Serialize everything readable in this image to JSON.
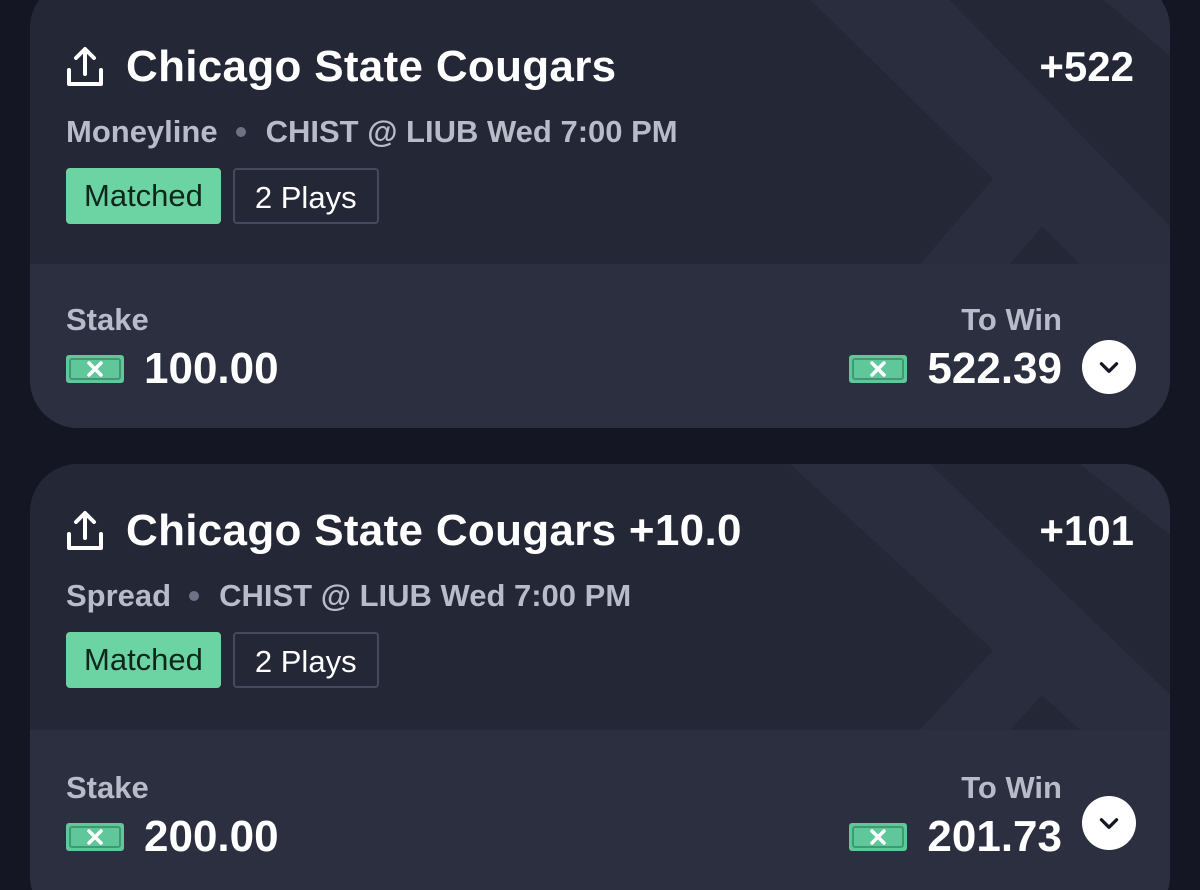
{
  "bets": [
    {
      "title": "Chicago State Cougars",
      "odds": "+522",
      "bet_type": "Moneyline",
      "matchup": "CHIST @ LIUB Wed 7:00 PM",
      "status": "Matched",
      "plays": "2 Plays",
      "stake_label": "Stake",
      "stake": "100.00",
      "win_label": "To Win",
      "to_win": "522.39"
    },
    {
      "title": "Chicago State Cougars +10.0",
      "odds": "+101",
      "bet_type": "Spread",
      "matchup": "CHIST @ LIUB Wed 7:00 PM",
      "status": "Matched",
      "plays": "2 Plays",
      "stake_label": "Stake",
      "stake": "200.00",
      "win_label": "To Win",
      "to_win": "201.73"
    }
  ],
  "icons": {
    "share": "share-icon",
    "cash": "cash-icon",
    "expand": "chevron-down-icon"
  },
  "colors": {
    "background": "#141624",
    "card": "#242736",
    "card_bottom": "#2c2f40",
    "matched_badge": "#6cd4a3",
    "cash_icon": "#5fc79a"
  }
}
